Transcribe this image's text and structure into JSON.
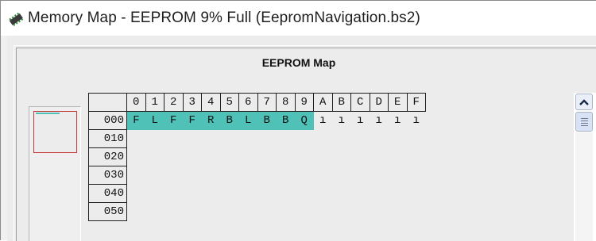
{
  "window": {
    "title": "Memory Map - EEPROM 9% Full (EepromNavigation.bs2)"
  },
  "map": {
    "label": "EEPROM Map",
    "column_headers": [
      "0",
      "1",
      "2",
      "3",
      "4",
      "5",
      "6",
      "7",
      "8",
      "9",
      "A",
      "B",
      "C",
      "D",
      "E",
      "F"
    ],
    "rows": [
      {
        "address": "000",
        "cells": [
          "F",
          "L",
          "F",
          "F",
          "R",
          "B",
          "L",
          "B",
          "B",
          "Q",
          "ı",
          "ı",
          "ı",
          "ı",
          "ı",
          "ı"
        ]
      },
      {
        "address": "010",
        "cells": [
          "",
          "",
          "",
          "",
          "",
          "",
          "",
          "",
          "",
          "",
          "",
          "",
          "",
          "",
          "",
          ""
        ]
      },
      {
        "address": "020",
        "cells": [
          "",
          "",
          "",
          "",
          "",
          "",
          "",
          "",
          "",
          "",
          "",
          "",
          "",
          "",
          "",
          ""
        ]
      },
      {
        "address": "030",
        "cells": [
          "",
          "",
          "",
          "",
          "",
          "",
          "",
          "",
          "",
          "",
          "",
          "",
          "",
          "",
          "",
          ""
        ]
      },
      {
        "address": "040",
        "cells": [
          "",
          "",
          "",
          "",
          "",
          "",
          "",
          "",
          "",
          "",
          "",
          "",
          "",
          "",
          "",
          ""
        ]
      },
      {
        "address": "050",
        "cells": [
          "",
          "",
          "",
          "",
          "",
          "",
          "",
          "",
          "",
          "",
          "",
          "",
          "",
          "",
          "",
          ""
        ]
      }
    ]
  },
  "colors": {
    "used_memory": "#4fc1b6",
    "overview_frame": "#c23a3a"
  },
  "icons": {
    "title": "eeprom-chip-icon",
    "scroll_up": "chevron-up-icon",
    "scroll_thumb": "grip-icon"
  }
}
